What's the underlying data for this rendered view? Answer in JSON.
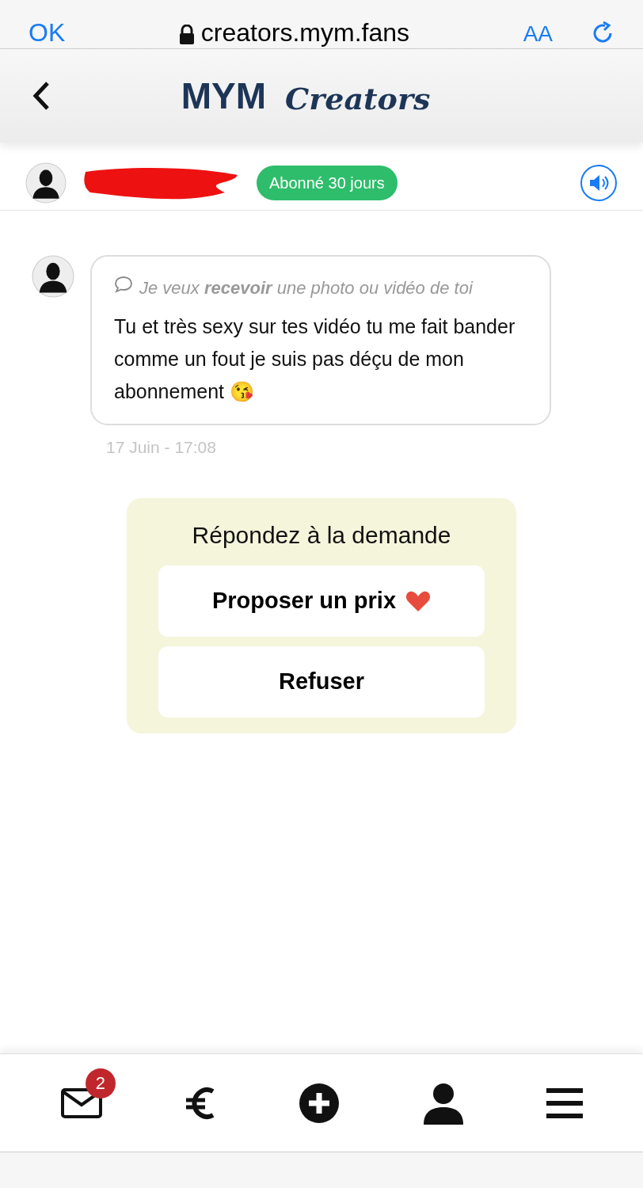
{
  "browser_top": {
    "done": "OK",
    "url": "creators.mym.fans",
    "text_size": "AA"
  },
  "header": {
    "logo_main": "MYM",
    "logo_sub": "Creators"
  },
  "subscriber": {
    "badge": "Abonné 30 jours",
    "name_redacted": true
  },
  "message": {
    "request": "Je veux **recevoir** une photo ou vidéo de toi",
    "text": "Tu et très sexy sur tes vidéo tu me fait bander comme un fout je suis pas déçu de mon abonnement 😘",
    "time": "17 Juin - 17:08"
  },
  "response_card": {
    "title": "Répondez à la demande",
    "buttons": [
      {
        "label": "Proposer un prix",
        "kind": "heart"
      },
      {
        "label": "Refuser",
        "kind": "plain"
      }
    ]
  },
  "bottom_nav": {
    "unread": "2"
  }
}
